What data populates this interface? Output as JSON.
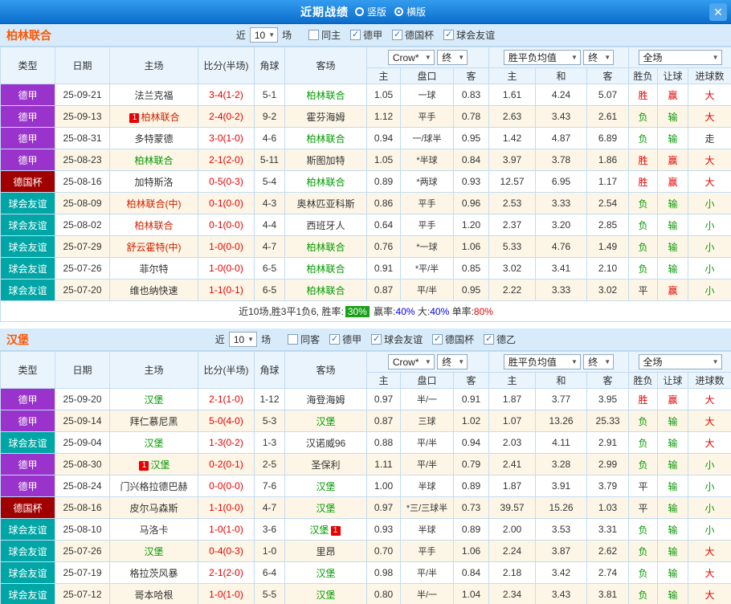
{
  "titlebar": {
    "title": "近期战绩",
    "layout_options": [
      {
        "label": "竖版",
        "selected": false
      },
      {
        "label": "横版",
        "selected": true
      }
    ],
    "close_label": "✕"
  },
  "filter_common": {
    "near": "近",
    "count": "10",
    "games": "场"
  },
  "controls": {
    "company": "Crow*",
    "final": "终",
    "avg": "胜平负均值",
    "scope": "全场"
  },
  "columns": {
    "type": "类型",
    "date": "日期",
    "home": "主场",
    "score": "比分(半场)",
    "corner": "角球",
    "away": "客场",
    "asian": [
      "主",
      "盘口",
      "客"
    ],
    "europe": [
      "主",
      "和",
      "客"
    ],
    "result": "胜负",
    "let": "让球",
    "goals": "进球数"
  },
  "colors": {
    "league": {
      "德甲": "#9933CC",
      "德国杯": "#A00000",
      "球会友谊": "#00A6A6"
    },
    "team": {
      "green": "#009900",
      "red": "#CC2200",
      "black": "#333333"
    },
    "outcome": {
      "胜": "#E60000",
      "负": "#0A9A0A",
      "平": "#333333",
      "赢": "#E60000",
      "输": "#0A9A0A",
      "走": "#333333",
      "大": "#E60000",
      "小": "#0A9A0A"
    },
    "score": "#E60000",
    "summary": {
      "blue": "#0000EE",
      "red": "#E60000"
    }
  },
  "sections": [
    {
      "team": "柏林联合",
      "checkboxes": [
        {
          "label": "同主",
          "checked": false
        },
        {
          "label": "德甲",
          "checked": true
        },
        {
          "label": "德国杯",
          "checked": true
        },
        {
          "label": "球会友谊",
          "checked": true
        }
      ],
      "rows": [
        {
          "league": "德甲",
          "date": "25-09-21",
          "home": {
            "name": "法兰克福",
            "color": "black"
          },
          "score": "3-4(1-2)",
          "corners": "5-1",
          "away": {
            "name": "柏林联合",
            "color": "green"
          },
          "asian": [
            "1.05",
            "一球",
            "0.83"
          ],
          "europe": [
            "1.61",
            "4.24",
            "5.07"
          ],
          "result": "胜",
          "let": "赢",
          "goals": "大"
        },
        {
          "league": "德甲",
          "date": "25-09-13",
          "home": {
            "name": "柏林联合",
            "color": "red",
            "badge": "1",
            "badge_pos": "before"
          },
          "score": "2-4(0-2)",
          "corners": "9-2",
          "away": {
            "name": "霍芬海姆",
            "color": "black"
          },
          "asian": [
            "1.12",
            "平手",
            "0.78"
          ],
          "europe": [
            "2.63",
            "3.43",
            "2.61"
          ],
          "result": "负",
          "let": "输",
          "goals": "大"
        },
        {
          "league": "德甲",
          "date": "25-08-31",
          "home": {
            "name": "多特蒙德",
            "color": "black"
          },
          "score": "3-0(1-0)",
          "corners": "4-6",
          "away": {
            "name": "柏林联合",
            "color": "green"
          },
          "asian": [
            "0.94",
            "一/球半",
            "0.95"
          ],
          "europe": [
            "1.42",
            "4.87",
            "6.89"
          ],
          "result": "负",
          "let": "输",
          "goals": "走"
        },
        {
          "league": "德甲",
          "date": "25-08-23",
          "home": {
            "name": "柏林联合",
            "color": "green"
          },
          "score": "2-1(2-0)",
          "corners": "5-11",
          "away": {
            "name": "斯图加特",
            "color": "black"
          },
          "asian": [
            "1.05",
            "*半球",
            "0.84"
          ],
          "europe": [
            "3.97",
            "3.78",
            "1.86"
          ],
          "result": "胜",
          "let": "赢",
          "goals": "大"
        },
        {
          "league": "德国杯",
          "date": "25-08-16",
          "home": {
            "name": "加特斯洛",
            "color": "black"
          },
          "score": "0-5(0-3)",
          "corners": "5-4",
          "away": {
            "name": "柏林联合",
            "color": "green"
          },
          "asian": [
            "0.89",
            "*两球",
            "0.93"
          ],
          "europe": [
            "12.57",
            "6.95",
            "1.17"
          ],
          "result": "胜",
          "let": "赢",
          "goals": "大"
        },
        {
          "league": "球会友谊",
          "date": "25-08-09",
          "home": {
            "name": "柏林联合(中)",
            "color": "red"
          },
          "score": "0-1(0-0)",
          "corners": "4-3",
          "away": {
            "name": "奥林匹亚科斯",
            "color": "black"
          },
          "asian": [
            "0.86",
            "平手",
            "0.96"
          ],
          "europe": [
            "2.53",
            "3.33",
            "2.54"
          ],
          "result": "负",
          "let": "输",
          "goals": "小"
        },
        {
          "league": "球会友谊",
          "date": "25-08-02",
          "home": {
            "name": "柏林联合",
            "color": "red"
          },
          "score": "0-1(0-0)",
          "corners": "4-4",
          "away": {
            "name": "西班牙人",
            "color": "black"
          },
          "asian": [
            "0.64",
            "平手",
            "1.20"
          ],
          "europe": [
            "2.37",
            "3.20",
            "2.85"
          ],
          "result": "负",
          "let": "输",
          "goals": "小"
        },
        {
          "league": "球会友谊",
          "date": "25-07-29",
          "home": {
            "name": "舒云霍特(中)",
            "color": "red"
          },
          "score": "1-0(0-0)",
          "corners": "4-7",
          "away": {
            "name": "柏林联合",
            "color": "green"
          },
          "asian": [
            "0.76",
            "*一球",
            "1.06"
          ],
          "europe": [
            "5.33",
            "4.76",
            "1.49"
          ],
          "result": "负",
          "let": "输",
          "goals": "小"
        },
        {
          "league": "球会友谊",
          "date": "25-07-26",
          "home": {
            "name": "菲尔特",
            "color": "black"
          },
          "score": "1-0(0-0)",
          "corners": "6-5",
          "away": {
            "name": "柏林联合",
            "color": "green"
          },
          "asian": [
            "0.91",
            "*平/半",
            "0.85"
          ],
          "europe": [
            "3.02",
            "3.41",
            "2.10"
          ],
          "result": "负",
          "let": "输",
          "goals": "小"
        },
        {
          "league": "球会友谊",
          "date": "25-07-20",
          "home": {
            "name": "维也纳快速",
            "color": "black"
          },
          "score": "1-1(0-1)",
          "corners": "6-5",
          "away": {
            "name": "柏林联合",
            "color": "green"
          },
          "asian": [
            "0.87",
            "平/半",
            "0.95"
          ],
          "europe": [
            "2.22",
            "3.33",
            "3.02"
          ],
          "result": "平",
          "let": "赢",
          "goals": "小"
        }
      ],
      "summary": {
        "prefix": "近10场,胜3平1负6, 胜率:",
        "win_rate": "30%",
        "items": [
          {
            "label": "赢率:",
            "value": "40%",
            "color": "blue"
          },
          {
            "label": "大:",
            "value": "40%",
            "color": "blue"
          },
          {
            "label": "单率:",
            "value": "80%",
            "color": "red"
          }
        ]
      }
    },
    {
      "team": "汉堡",
      "checkboxes": [
        {
          "label": "同客",
          "checked": false
        },
        {
          "label": "德甲",
          "checked": true
        },
        {
          "label": "球会友谊",
          "checked": true
        },
        {
          "label": "德国杯",
          "checked": true
        },
        {
          "label": "德乙",
          "checked": true
        }
      ],
      "rows": [
        {
          "league": "德甲",
          "date": "25-09-20",
          "home": {
            "name": "汉堡",
            "color": "green"
          },
          "score": "2-1(1-0)",
          "corners": "1-12",
          "away": {
            "name": "海登海姆",
            "color": "black"
          },
          "asian": [
            "0.97",
            "半/一",
            "0.91"
          ],
          "europe": [
            "1.87",
            "3.77",
            "3.95"
          ],
          "result": "胜",
          "let": "赢",
          "goals": "大"
        },
        {
          "league": "德甲",
          "date": "25-09-14",
          "home": {
            "name": "拜仁慕尼黑",
            "color": "black"
          },
          "score": "5-0(4-0)",
          "corners": "5-3",
          "away": {
            "name": "汉堡",
            "color": "green"
          },
          "asian": [
            "0.87",
            "三球",
            "1.02"
          ],
          "europe": [
            "1.07",
            "13.26",
            "25.33"
          ],
          "result": "负",
          "let": "输",
          "goals": "大"
        },
        {
          "league": "球会友谊",
          "date": "25-09-04",
          "home": {
            "name": "汉堡",
            "color": "green"
          },
          "score": "1-3(0-2)",
          "corners": "1-3",
          "away": {
            "name": "汉诺威96",
            "color": "black"
          },
          "asian": [
            "0.88",
            "平/半",
            "0.94"
          ],
          "europe": [
            "2.03",
            "4.11",
            "2.91"
          ],
          "result": "负",
          "let": "输",
          "goals": "大"
        },
        {
          "league": "德甲",
          "date": "25-08-30",
          "home": {
            "name": "汉堡",
            "color": "green",
            "badge": "1",
            "badge_pos": "before"
          },
          "score": "0-2(0-1)",
          "corners": "2-5",
          "away": {
            "name": "圣保利",
            "color": "black"
          },
          "asian": [
            "1.11",
            "平/半",
            "0.79"
          ],
          "europe": [
            "2.41",
            "3.28",
            "2.99"
          ],
          "result": "负",
          "let": "输",
          "goals": "小"
        },
        {
          "league": "德甲",
          "date": "25-08-24",
          "home": {
            "name": "门兴格拉德巴赫",
            "color": "black"
          },
          "score": "0-0(0-0)",
          "corners": "7-6",
          "away": {
            "name": "汉堡",
            "color": "green"
          },
          "asian": [
            "1.00",
            "半球",
            "0.89"
          ],
          "europe": [
            "1.87",
            "3.91",
            "3.79"
          ],
          "result": "平",
          "let": "输",
          "goals": "小"
        },
        {
          "league": "德国杯",
          "date": "25-08-16",
          "home": {
            "name": "皮尔马森斯",
            "color": "black"
          },
          "score": "1-1(0-0)",
          "corners": "4-7",
          "away": {
            "name": "汉堡",
            "color": "green"
          },
          "asian": [
            "0.97",
            "*三/三球半",
            "0.73"
          ],
          "europe": [
            "39.57",
            "15.26",
            "1.03"
          ],
          "result": "平",
          "let": "输",
          "goals": "小"
        },
        {
          "league": "球会友谊",
          "date": "25-08-10",
          "home": {
            "name": "马洛卡",
            "color": "black"
          },
          "score": "1-0(1-0)",
          "corners": "3-6",
          "away": {
            "name": "汉堡",
            "color": "green",
            "badge": "1",
            "badge_pos": "after"
          },
          "asian": [
            "0.93",
            "半球",
            "0.89"
          ],
          "europe": [
            "2.00",
            "3.53",
            "3.31"
          ],
          "result": "负",
          "let": "输",
          "goals": "小"
        },
        {
          "league": "球会友谊",
          "date": "25-07-26",
          "home": {
            "name": "汉堡",
            "color": "green"
          },
          "score": "0-4(0-3)",
          "corners": "1-0",
          "away": {
            "name": "里昂",
            "color": "black"
          },
          "asian": [
            "0.70",
            "平手",
            "1.06"
          ],
          "europe": [
            "2.24",
            "3.87",
            "2.62"
          ],
          "result": "负",
          "let": "输",
          "goals": "大"
        },
        {
          "league": "球会友谊",
          "date": "25-07-19",
          "home": {
            "name": "格拉茨风暴",
            "color": "black"
          },
          "score": "2-1(2-0)",
          "corners": "6-4",
          "away": {
            "name": "汉堡",
            "color": "green"
          },
          "asian": [
            "0.98",
            "平/半",
            "0.84"
          ],
          "europe": [
            "2.18",
            "3.42",
            "2.74"
          ],
          "result": "负",
          "let": "输",
          "goals": "大"
        },
        {
          "league": "球会友谊",
          "date": "25-07-12",
          "home": {
            "name": "哥本哈根",
            "color": "black"
          },
          "score": "1-0(1-0)",
          "corners": "5-5",
          "away": {
            "name": "汉堡",
            "color": "green"
          },
          "asian": [
            "0.80",
            "半/一",
            "1.04"
          ],
          "europe": [
            "2.34",
            "3.43",
            "3.81"
          ],
          "result": "负",
          "let": "输",
          "goals": "大"
        }
      ]
    }
  ]
}
